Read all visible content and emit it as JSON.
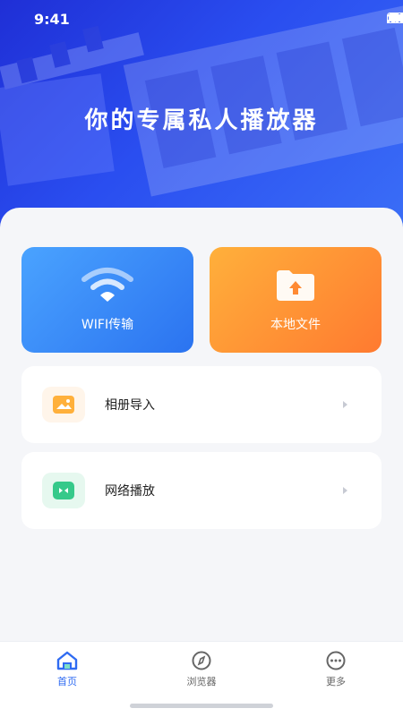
{
  "status_bar": {
    "time": "9:41"
  },
  "hero": {
    "title": "你的专属私人播放器"
  },
  "cards": [
    {
      "label": "WIFI传输",
      "icon": "wifi-icon",
      "color_start": "#4aa3ff",
      "color_end": "#2b73f0"
    },
    {
      "label": "本地文件",
      "icon": "folder-upload-icon",
      "color_start": "#ffb03b",
      "color_end": "#ff7a30"
    }
  ],
  "list": [
    {
      "label": "相册导入",
      "icon": "photo-album-icon",
      "color": "#ffb03b"
    },
    {
      "label": "网络播放",
      "icon": "network-play-icon",
      "color": "#36c98a"
    }
  ],
  "tabbar": {
    "items": [
      {
        "label": "首页",
        "icon": "home-icon",
        "active": true
      },
      {
        "label": "浏览器",
        "icon": "compass-icon",
        "active": false
      },
      {
        "label": "更多",
        "icon": "more-icon",
        "active": false
      }
    ],
    "active_color": "#2f6bf2"
  }
}
